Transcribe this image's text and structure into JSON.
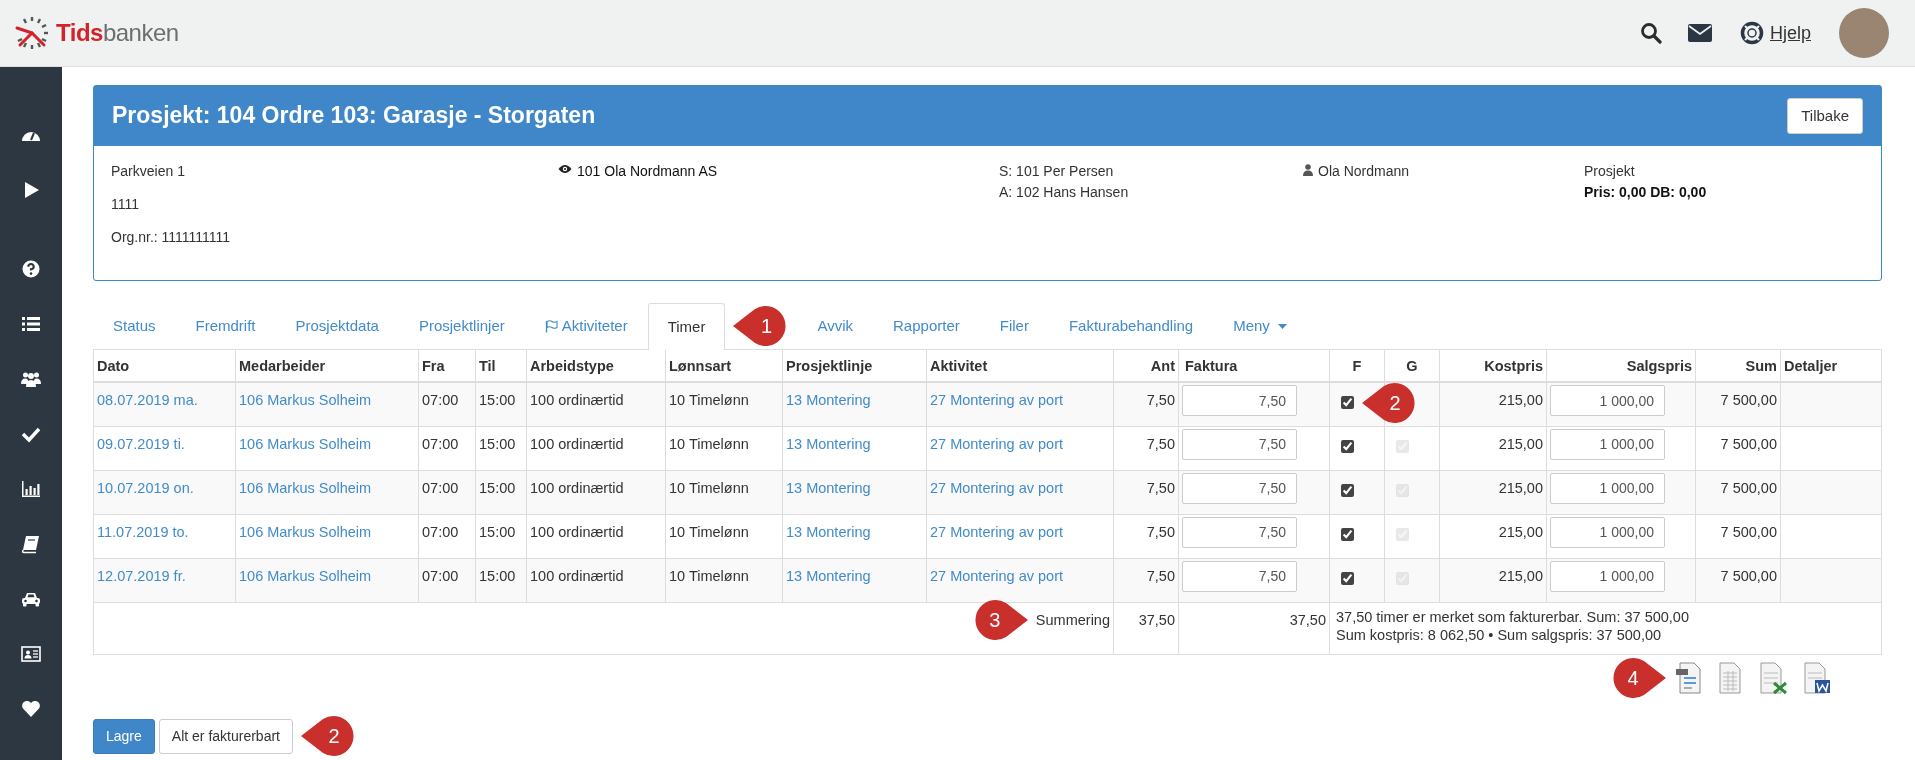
{
  "header": {
    "logo_parts": [
      "Tids",
      "banken"
    ],
    "help_label": "Hjelp"
  },
  "project": {
    "title": "Prosjekt: 104 Ordre 103: Garasje - Storgaten",
    "back_button": "Tilbake",
    "address_lines": [
      "Parkveien 1",
      "1111",
      "Org.nr.: 1111111111"
    ],
    "customer": "101 Ola Nordmann AS",
    "responsible_lines": [
      "S: 101 Per Persen",
      "A: 102 Hans Hansen"
    ],
    "contact": "Ola Nordmann",
    "type": "Prosjekt",
    "price": "Pris: 0,00 DB: 0,00"
  },
  "tabs": [
    {
      "label": "Status",
      "selected": false,
      "kind": "plain"
    },
    {
      "label": "Fremdrift",
      "selected": false,
      "kind": "plain"
    },
    {
      "label": "Prosjektdata",
      "selected": false,
      "kind": "plain"
    },
    {
      "label": "Prosjektlinjer",
      "selected": false,
      "kind": "plain"
    },
    {
      "label": "Aktiviteter",
      "selected": false,
      "kind": "flag"
    },
    {
      "label": "Timer",
      "selected": true,
      "kind": "plain",
      "callout": {
        "number": "1",
        "kind": "leftward"
      }
    },
    {
      "label": "Avvik",
      "selected": false,
      "kind": "plain"
    },
    {
      "label": "Rapporter",
      "selected": false,
      "kind": "plain"
    },
    {
      "label": "Filer",
      "selected": false,
      "kind": "plain"
    },
    {
      "label": "Fakturabehandling",
      "selected": false,
      "kind": "plain"
    },
    {
      "label": "Meny",
      "selected": false,
      "kind": "dropdown"
    }
  ],
  "table": {
    "columns": [
      "Dato",
      "Medarbeider",
      "Fra",
      "Til",
      "Arbeidstype",
      "Lønnsart",
      "Prosjektlinje",
      "Aktivitet",
      "Ant",
      "Faktura",
      "F",
      "G",
      "Kostpris",
      "Salgspris",
      "Sum",
      "Detaljer"
    ],
    "rows": [
      {
        "date": "08.07.2019 ma.",
        "employee": "106 Markus Solheim",
        "from": "07:00",
        "to": "15:00",
        "work_type": "100 ordinærtid",
        "wage_type": "10 Timelønn",
        "project_line": "13 Montering",
        "activity": "27 Montering av port",
        "ant": "7,50",
        "faktura": "7,50",
        "f_checked": true,
        "kostpris": "215,00",
        "salgspris": "1 000,00",
        "sum": "7 500,00",
        "callout": {
          "number": "2",
          "kind": "leftward"
        }
      },
      {
        "date": "09.07.2019 ti.",
        "employee": "106 Markus Solheim",
        "from": "07:00",
        "to": "15:00",
        "work_type": "100 ordinærtid",
        "wage_type": "10 Timelønn",
        "project_line": "13 Montering",
        "activity": "27 Montering av port",
        "ant": "7,50",
        "faktura": "7,50",
        "f_checked": true,
        "g_checked": true,
        "g_disabled": true,
        "kostpris": "215,00",
        "salgspris": "1 000,00",
        "sum": "7 500,00"
      },
      {
        "date": "10.07.2019 on.",
        "employee": "106 Markus Solheim",
        "from": "07:00",
        "to": "15:00",
        "work_type": "100 ordinærtid",
        "wage_type": "10 Timelønn",
        "project_line": "13 Montering",
        "activity": "27 Montering av port",
        "ant": "7,50",
        "faktura": "7,50",
        "f_checked": true,
        "g_checked": true,
        "g_disabled": true,
        "kostpris": "215,00",
        "salgspris": "1 000,00",
        "sum": "7 500,00"
      },
      {
        "date": "11.07.2019 to.",
        "employee": "106 Markus Solheim",
        "from": "07:00",
        "to": "15:00",
        "work_type": "100 ordinærtid",
        "wage_type": "10 Timelønn",
        "project_line": "13 Montering",
        "activity": "27 Montering av port",
        "ant": "7,50",
        "faktura": "7,50",
        "f_checked": true,
        "g_checked": true,
        "g_disabled": true,
        "kostpris": "215,00",
        "salgspris": "1 000,00",
        "sum": "7 500,00"
      },
      {
        "date": "12.07.2019 fr.",
        "employee": "106 Markus Solheim",
        "from": "07:00",
        "to": "15:00",
        "work_type": "100 ordinærtid",
        "wage_type": "10 Timelønn",
        "project_line": "13 Montering",
        "activity": "27 Montering av port",
        "ant": "7,50",
        "faktura": "7,50",
        "f_checked": true,
        "g_checked": true,
        "g_disabled": true,
        "kostpris": "215,00",
        "salgspris": "1 000,00",
        "sum": "7 500,00"
      }
    ],
    "summary": {
      "label": "Summering",
      "ant": "37,50",
      "faktura": "37,50",
      "note_lines": [
        "37,50 timer er merket som fakturerbar. Sum: 37 500,00",
        "Sum kostpris: 8 062,50 • Sum salgspris: 37 500,00"
      ],
      "callout": {
        "number": "3",
        "kind": "rightward"
      }
    }
  },
  "exports": {
    "callout": {
      "number": "4",
      "kind": "rightward"
    }
  },
  "buttons": [
    {
      "label": "Lagre",
      "kind": "primary"
    },
    {
      "label": "Alt er fakturerbart",
      "kind": "secondary",
      "callout": {
        "number": "2",
        "kind": "leftward"
      }
    }
  ]
}
